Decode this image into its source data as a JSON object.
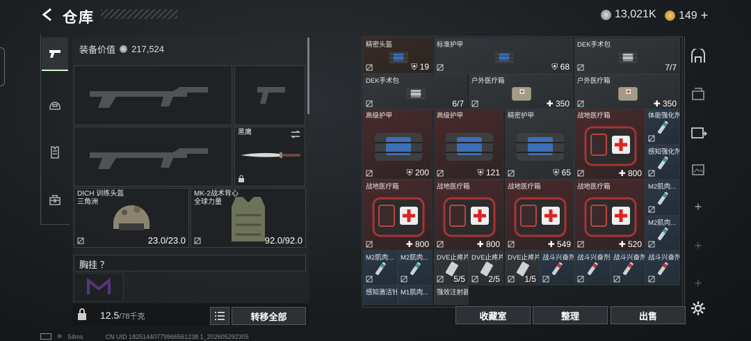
{
  "header": {
    "title": "仓库",
    "currency_main": "13,021K",
    "currency_premium": "149",
    "premium_plus": "+"
  },
  "loadout": {
    "equipment_value_label": "装备价值",
    "equipment_value": "217,524",
    "knife_name": "黑鹰",
    "helmet": {
      "name": "DICH 训练头盔",
      "sub": "三角洲",
      "durability": "23.0/23.0"
    },
    "armor": {
      "name": "MK-2战术背心",
      "sub": "全球力量",
      "durability": "92.0/92.0"
    },
    "chest_label": "胸挂 ？",
    "weight_current": "12.5",
    "weight_max": "/78千克",
    "transfer_all": "转移全部"
  },
  "stash": {
    "items": [
      {
        "label": "精密头盔",
        "count": "19",
        "kind": "shield",
        "bg": "brown"
      },
      {
        "label": "标准护甲",
        "count": "68",
        "kind": "shield",
        "bg": "grey"
      },
      {
        "label": "DEK手术包",
        "count": "7/7",
        "kind": "plain",
        "bg": "grey"
      },
      {
        "label": "DEK手术包",
        "count": "6/7",
        "kind": "plain",
        "bg": "grey"
      },
      {
        "label": "户外医疗箱",
        "count": "350",
        "kind": "plus",
        "bg": "grey"
      },
      {
        "label": "户外医疗箱",
        "count": "350",
        "kind": "plus",
        "bg": "grey"
      },
      {
        "label": "高级护甲",
        "count": "200",
        "kind": "shield",
        "bg": "red"
      },
      {
        "label": "高级护甲",
        "count": "121",
        "kind": "shield",
        "bg": "red"
      },
      {
        "label": "精密护甲",
        "count": "65",
        "kind": "shield",
        "bg": "grey"
      },
      {
        "label": "战地医疗箱",
        "count": "800",
        "kind": "plus",
        "bg": "red"
      },
      {
        "label": "体能强化剂",
        "count": "",
        "kind": "plain",
        "bg": "blue"
      },
      {
        "label": "感知强化剂",
        "count": "",
        "kind": "plain",
        "bg": "blue"
      },
      {
        "label": "战地医疗箱",
        "count": "800",
        "kind": "plus",
        "bg": "red"
      },
      {
        "label": "战地医疗箱",
        "count": "800",
        "kind": "plus",
        "bg": "red"
      },
      {
        "label": "战地医疗箱",
        "count": "549",
        "kind": "plus",
        "bg": "red"
      },
      {
        "label": "战地医疗箱",
        "count": "520",
        "kind": "plus",
        "bg": "red"
      },
      {
        "label": "M2肌肉...",
        "count": "",
        "kind": "plain",
        "bg": "blue"
      },
      {
        "label": "M2肌肉...",
        "count": "",
        "kind": "plain",
        "bg": "blue"
      },
      {
        "label": "M2肌肉...",
        "count": "",
        "kind": "plain",
        "bg": "blue"
      },
      {
        "label": "M2肌肉...",
        "count": "",
        "kind": "plain",
        "bg": "blue"
      },
      {
        "label": "DVE止疼片",
        "count": "5/5",
        "kind": "plain",
        "bg": "grey"
      },
      {
        "label": "DVE止疼片",
        "count": "2/5",
        "kind": "plain",
        "bg": "grey"
      },
      {
        "label": "DVE止疼片",
        "count": "1/5",
        "kind": "plain",
        "bg": "grey"
      },
      {
        "label": "战斗兴奋剂",
        "count": "",
        "kind": "plain",
        "bg": "blue"
      },
      {
        "label": "战斗兴奋剂",
        "count": "",
        "kind": "plain",
        "bg": "blue"
      },
      {
        "label": "战斗兴奋剂",
        "count": "",
        "kind": "plain",
        "bg": "blue"
      },
      {
        "label": "战斗兴奋剂",
        "count": "",
        "kind": "plain",
        "bg": "blue"
      },
      {
        "label": "感知激活针",
        "count": "",
        "kind": "plain",
        "bg": "blue"
      },
      {
        "label": "M1肌肉...",
        "count": "",
        "kind": "plain",
        "bg": "blue"
      },
      {
        "label": "强效注射器",
        "count": "",
        "kind": "plain",
        "bg": "grey"
      }
    ],
    "btn_collection": "收藏室",
    "btn_sort": "整理",
    "btn_sell": "出售"
  },
  "status": {
    "ping": "54ms",
    "uid": "CN UID 18251440779966561238 1_202605292305"
  },
  "colors": {
    "accent": "#c8ffd0",
    "red_item": "#4a2a2c",
    "blue_item": "#2b3a4a"
  }
}
